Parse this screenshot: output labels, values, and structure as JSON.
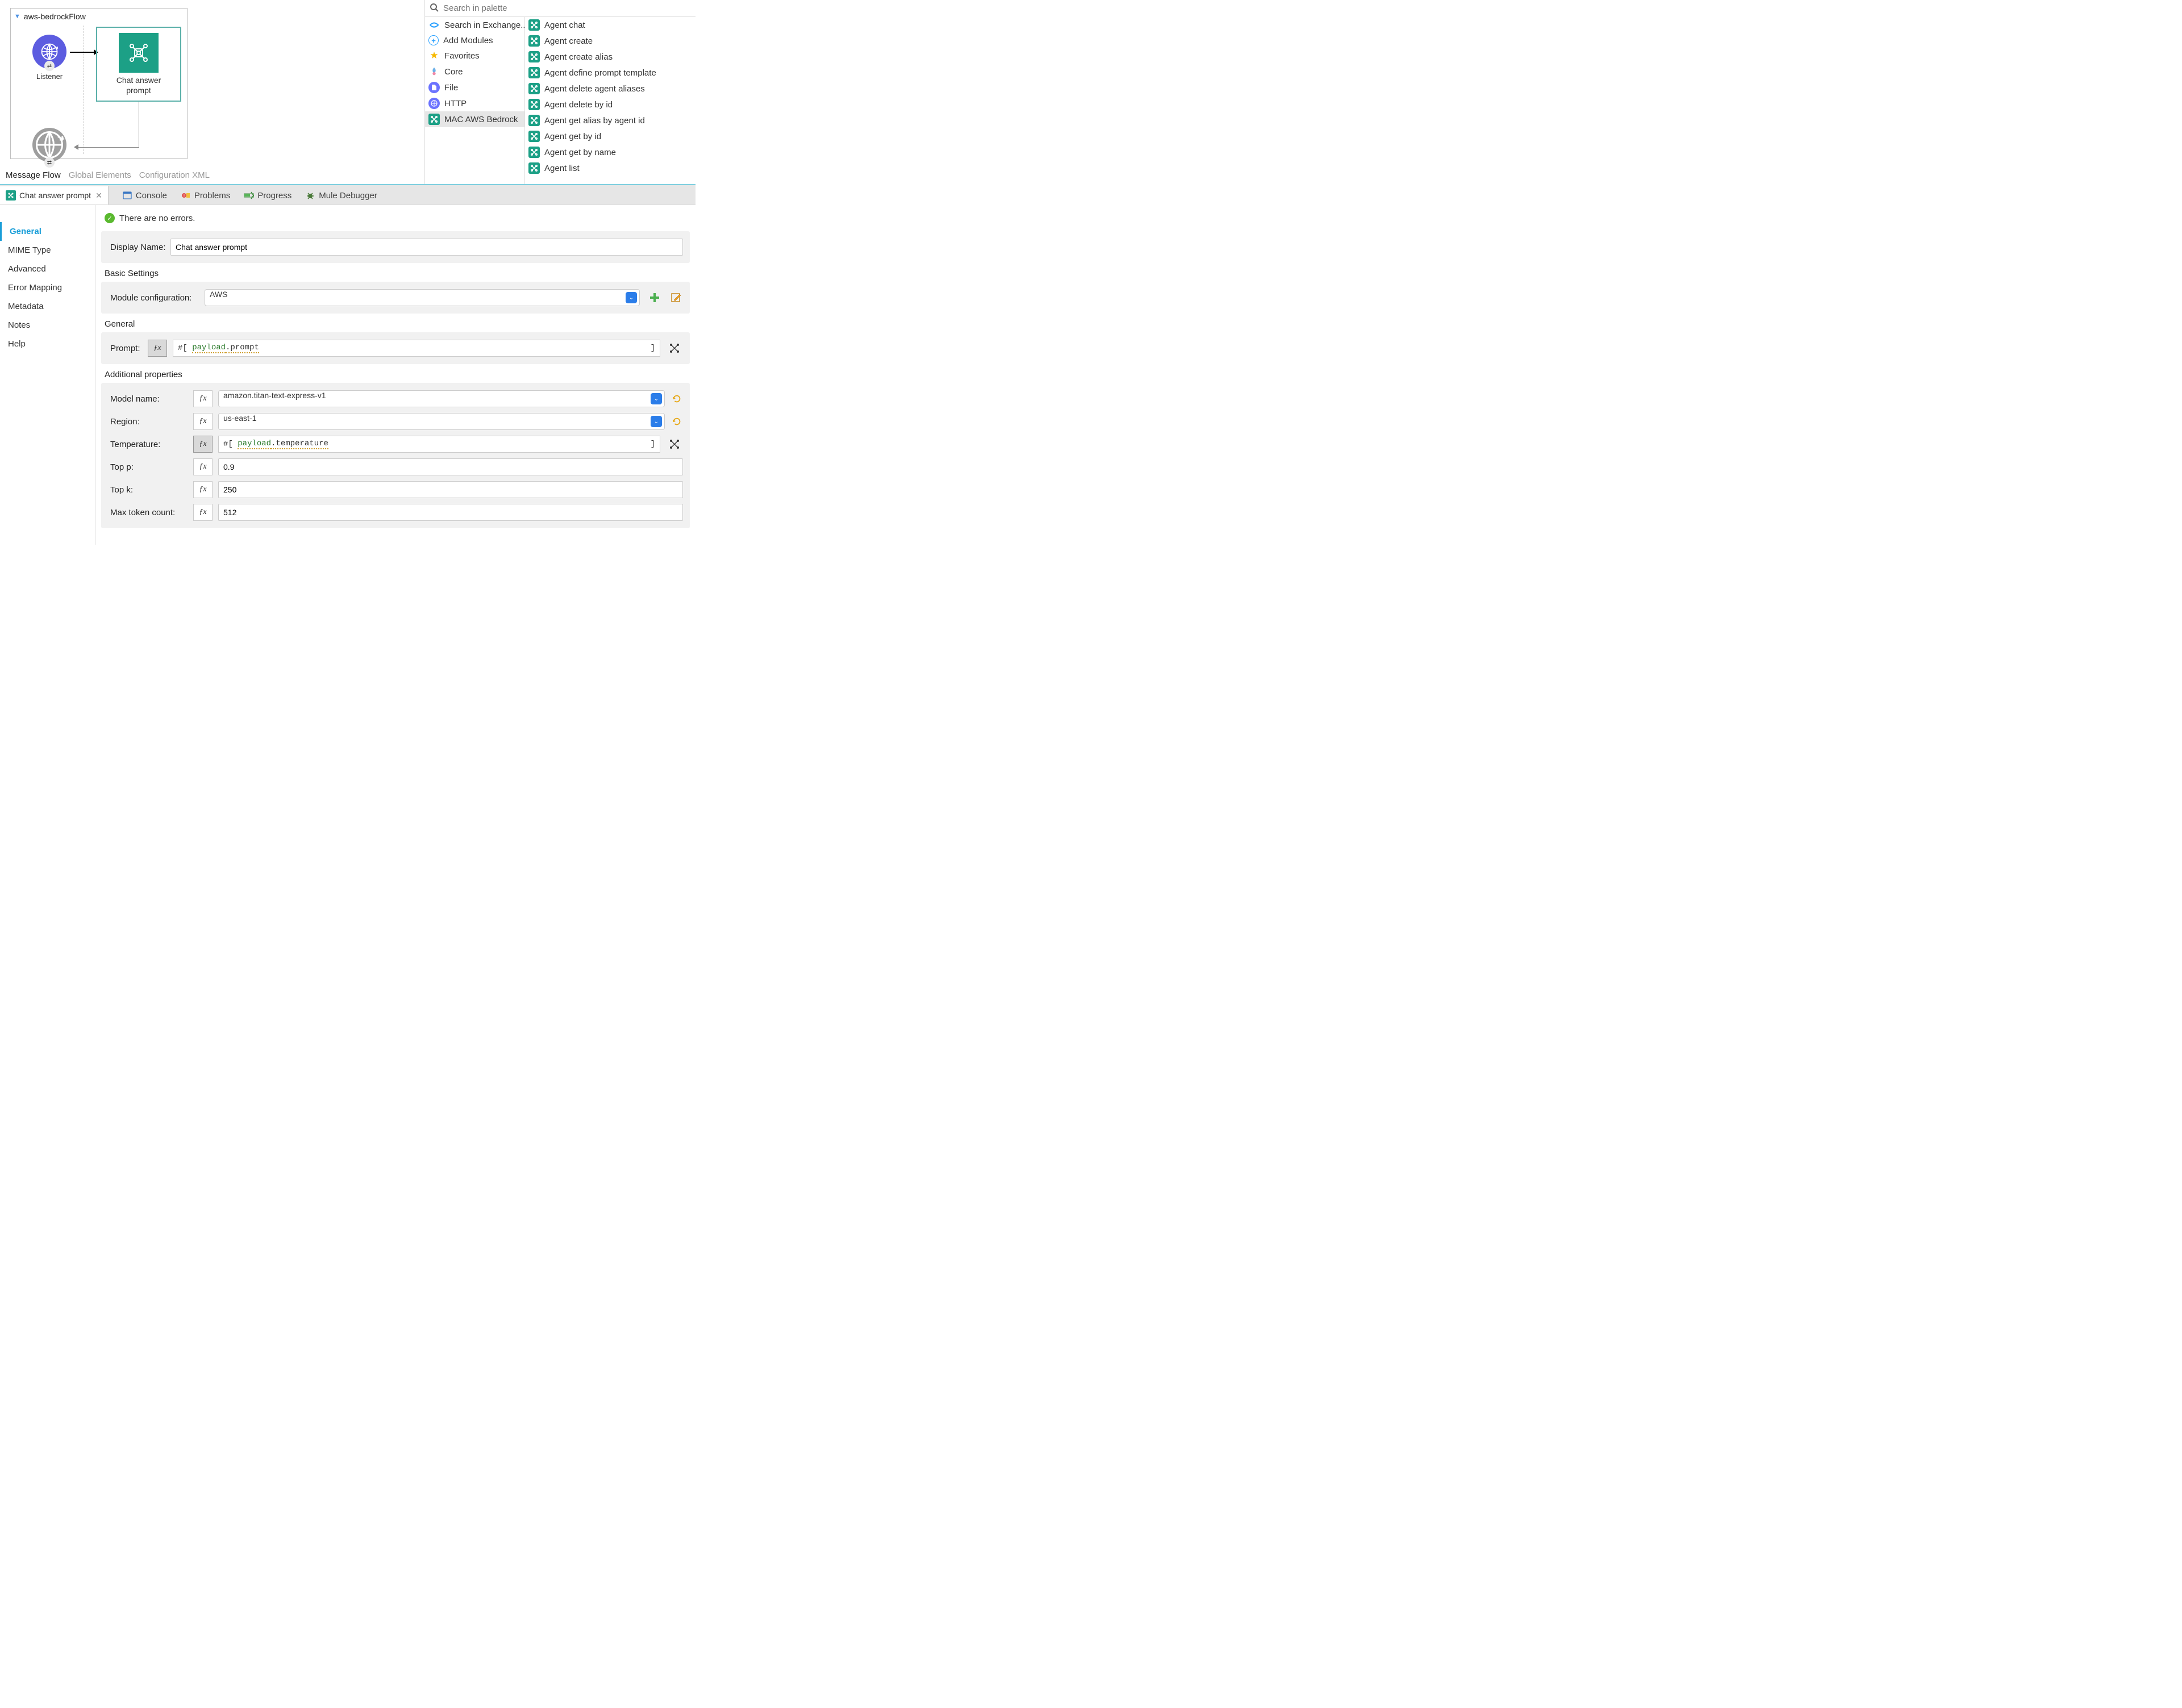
{
  "flow": {
    "name": "aws-bedrockFlow",
    "listener_label": "Listener",
    "prompt_label_line1": "Chat answer",
    "prompt_label_line2": "prompt"
  },
  "editor_tabs": {
    "message_flow": "Message Flow",
    "global_elements": "Global Elements",
    "config_xml": "Configuration XML"
  },
  "palette": {
    "search_placeholder": "Search in palette",
    "left": [
      {
        "label": "Search in Exchange..",
        "icon": "exchange"
      },
      {
        "label": "Add Modules",
        "icon": "plus"
      },
      {
        "label": "Favorites",
        "icon": "star"
      },
      {
        "label": "Core",
        "icon": "core"
      },
      {
        "label": "File",
        "icon": "file"
      },
      {
        "label": "HTTP",
        "icon": "http"
      },
      {
        "label": "MAC AWS Bedrock",
        "icon": "bedrock",
        "selected": true
      }
    ],
    "right": [
      "Agent chat",
      "Agent create",
      "Agent create alias",
      "Agent define prompt template",
      "Agent delete agent aliases",
      "Agent delete by id",
      "Agent get alias by agent id",
      "Agent get by id",
      "Agent get by name",
      "Agent list"
    ]
  },
  "lower_tabs": {
    "active": "Chat answer prompt",
    "others": [
      {
        "label": "Console",
        "icon": "console"
      },
      {
        "label": "Problems",
        "icon": "problems"
      },
      {
        "label": "Progress",
        "icon": "progress"
      },
      {
        "label": "Mule Debugger",
        "icon": "debugger"
      }
    ]
  },
  "sidebar": {
    "items": [
      "General",
      "MIME Type",
      "Advanced",
      "Error Mapping",
      "Metadata",
      "Notes",
      "Help"
    ],
    "active_index": 0
  },
  "status": "There are no errors.",
  "form": {
    "display_name_label": "Display Name:",
    "display_name_value": "Chat answer prompt",
    "basic_settings": "Basic Settings",
    "module_conf_label": "Module configuration:",
    "module_conf_value": "AWS",
    "general_head": "General",
    "prompt_label": "Prompt:",
    "prompt_expr_prefix": "#[",
    "prompt_expr_payload": "payload",
    "prompt_expr_rest": ".prompt",
    "additional_head": "Additional properties",
    "model_label": "Model name:",
    "model_value": "amazon.titan-text-express-v1",
    "region_label": "Region:",
    "region_value": "us-east-1",
    "temperature_label": "Temperature:",
    "temperature_expr_prefix": "#[",
    "temperature_expr_payload": "payload",
    "temperature_expr_rest": ".temperature",
    "topp_label": "Top p:",
    "topp_value": "0.9",
    "topk_label": "Top k:",
    "topk_value": "250",
    "maxtok_label": "Max token count:",
    "maxtok_value": "512"
  }
}
